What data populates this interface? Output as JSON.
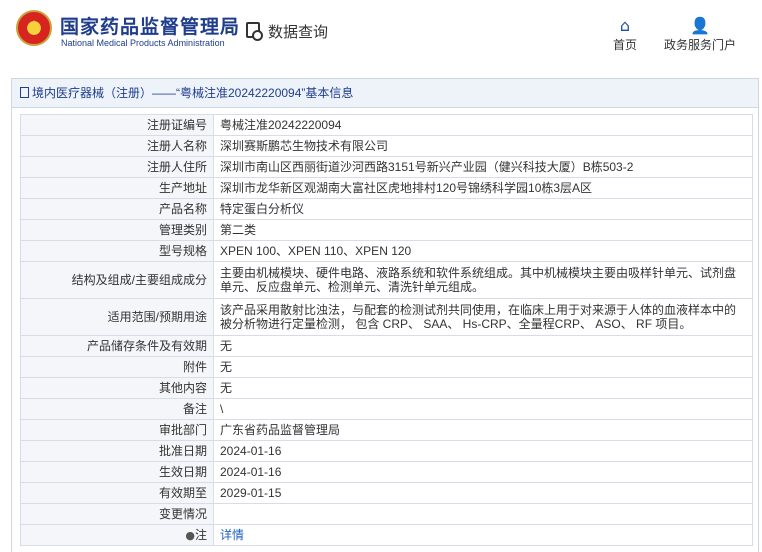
{
  "header": {
    "title_cn": "国家药品监督管理局",
    "title_en": "National Medical Products Administration",
    "query_label": "数据查询",
    "nav": [
      {
        "icon": "home-icon",
        "label": "首页"
      },
      {
        "icon": "user-icon",
        "label": "政务服务门户"
      }
    ]
  },
  "panel": {
    "heading": "境内医疗器械（注册）——“粤械注准20242220094”基本信息"
  },
  "record": [
    {
      "label": "注册证编号",
      "value": "粤械注准20242220094"
    },
    {
      "label": "注册人名称",
      "value": "深圳赛斯鹏芯生物技术有限公司"
    },
    {
      "label": "注册人住所",
      "value": "深圳市南山区西丽街道沙河西路3151号新兴产业园（健兴科技大厦）B栋503-2"
    },
    {
      "label": "生产地址",
      "value": "深圳市龙华新区观湖南大富社区虎地排村120号锦绣科学园10栋3层A区"
    },
    {
      "label": "产品名称",
      "value": "特定蛋白分析仪"
    },
    {
      "label": "管理类别",
      "value": "第二类"
    },
    {
      "label": "型号规格",
      "value": "XPEN 100、XPEN 110、XPEN 120"
    },
    {
      "label": "结构及组成/主要组成成分",
      "value": "主要由机械模块、硬件电路、液路系统和软件系统组成。其中机械模块主要由吸样针单元、试剂盘单元、反应盘单元、检测单元、清洗针单元组成。"
    },
    {
      "label": "适用范围/预期用途",
      "value": "该产品采用散射比浊法，与配套的检测试剂共同使用，在临床上用于对来源于人体的血液样本中的被分析物进行定量检测， 包含 CRP、 SAA、 Hs-CRP、全量程CRP、 ASO、 RF 项目。"
    },
    {
      "label": "产品储存条件及有效期",
      "value": "无"
    },
    {
      "label": "附件",
      "value": "无"
    },
    {
      "label": "其他内容",
      "value": "无"
    },
    {
      "label": "备注",
      "value": "\\"
    },
    {
      "label": "审批部门",
      "value": "广东省药品监督管理局"
    },
    {
      "label": "批准日期",
      "value": "2024-01-16"
    },
    {
      "label": "生效日期",
      "value": "2024-01-16"
    },
    {
      "label": "有效期至",
      "value": "2029-01-15"
    },
    {
      "label": "变更情况",
      "value": ""
    },
    {
      "label": "注",
      "value": "详情"
    }
  ]
}
